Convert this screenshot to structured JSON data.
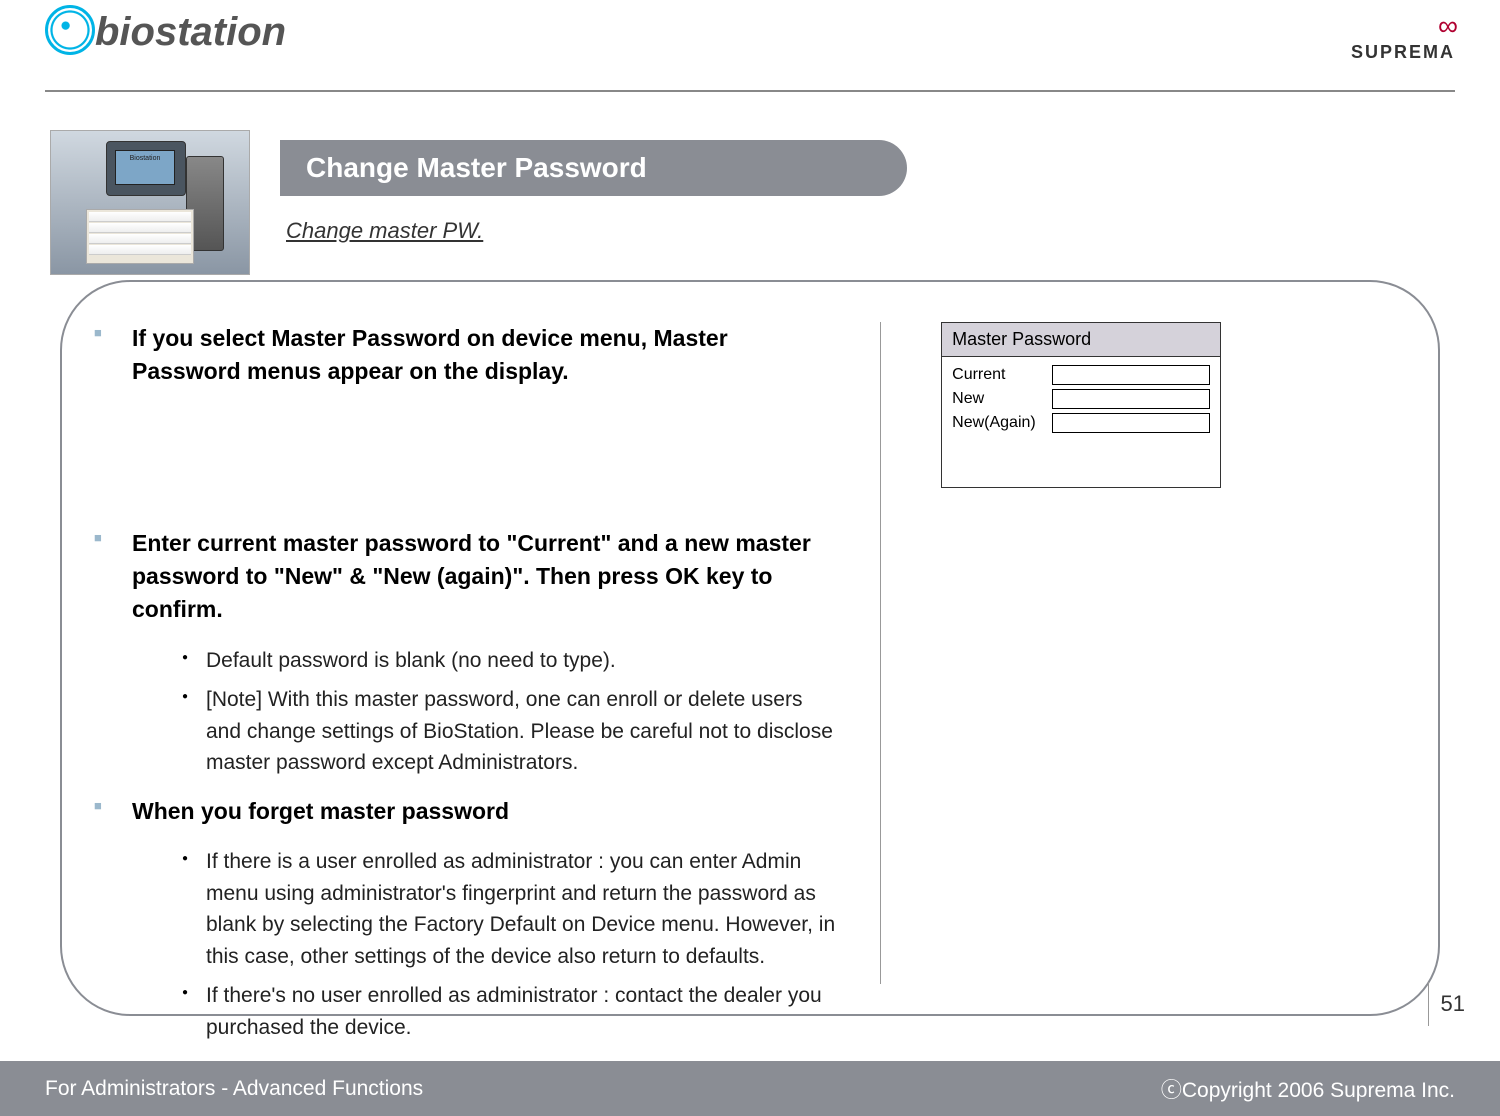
{
  "logoLeft": "biostation",
  "logoRight": "SUPREMA",
  "title": "Change Master Password",
  "subtitle": "Change master PW.",
  "thumbHeader": "Biostation",
  "bullets": {
    "b1": "If you select Master Password on device menu, Master Password menus appear on the display.",
    "b2": "Enter current master password to \"Current\" and a new master password to \"New\" & \"New (again)\". Then press OK key to confirm.",
    "b2s1": "Default password is blank (no need to type).",
    "b2s2": "[Note] With this master password, one can enroll or delete users and change settings of BioStation. Please be careful not to disclose master password except Administrators.",
    "b3": "When you forget master password",
    "b3s1": "If there is a user enrolled as administrator : you can enter Admin menu using administrator's fingerprint and return the password as blank by selecting the Factory Default on Device menu. However, in this case, other settings of the device also return to defaults.",
    "b3s2": "If there's no user enrolled as administrator : contact the dealer you purchased the device."
  },
  "uiBox": {
    "header": "Master Password",
    "row1": "Current",
    "row2": "New",
    "row3": "New(Again)"
  },
  "pageNum": "51",
  "footerLeft": "For Administrators - Advanced Functions",
  "footerRight": "ⓒCopyright 2006 Suprema Inc."
}
